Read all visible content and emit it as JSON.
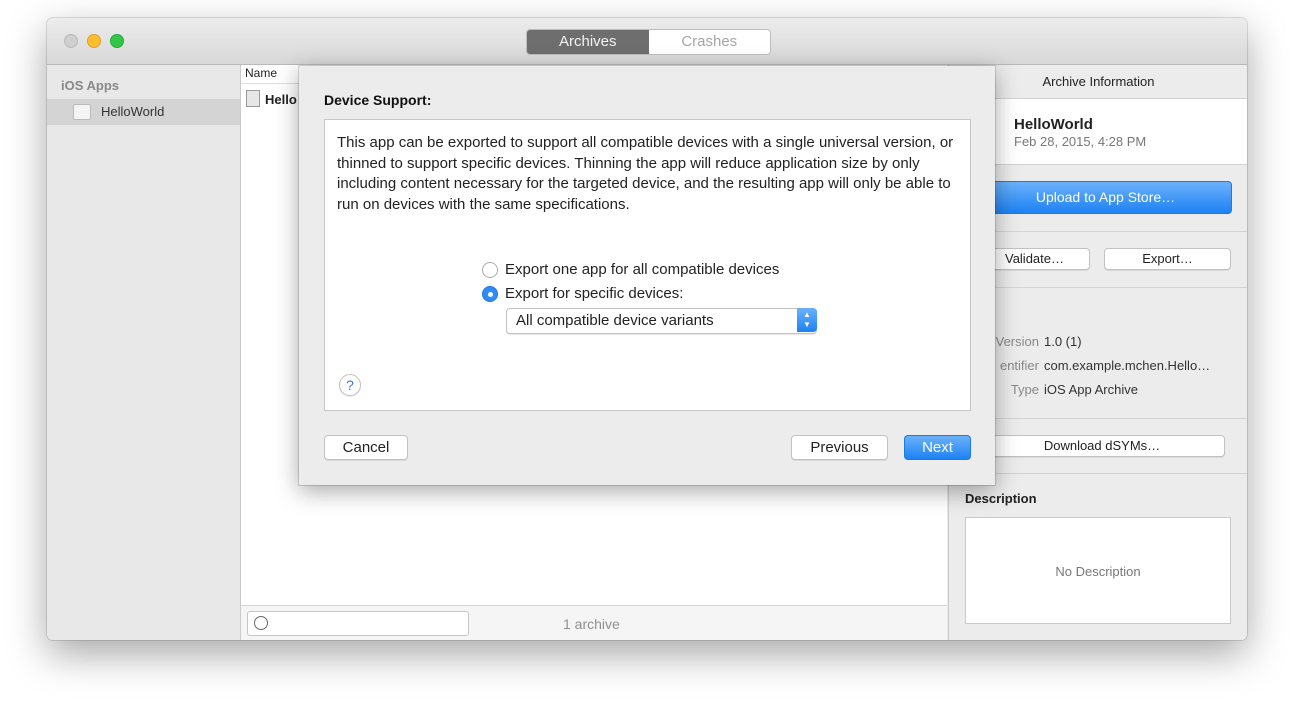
{
  "window": {
    "tabs": [
      {
        "label": "Archives",
        "active": true
      },
      {
        "label": "Crashes",
        "active": false
      }
    ]
  },
  "sidebar": {
    "header": "iOS Apps",
    "items": [
      {
        "label": "HelloWorld",
        "selected": true
      }
    ]
  },
  "list": {
    "column_header": "Name",
    "rows": [
      {
        "name": "Hello"
      }
    ],
    "footer": {
      "count": "1 archive",
      "filter_placeholder": ""
    }
  },
  "inspector": {
    "title": "Archive Information",
    "app_name": "HelloWorld",
    "date": "Feb 28, 2015, 4:28 PM",
    "upload_label": "Upload to App Store…",
    "validate_label": "Validate…",
    "export_label": "Export…",
    "details_header": "ils",
    "details": [
      {
        "key": "Version",
        "value": "1.0 (1)"
      },
      {
        "key": "entifier",
        "value": "com.example.mchen.Hello…"
      },
      {
        "key": "Type",
        "value": "iOS App Archive"
      }
    ],
    "dsyms_label": "Download dSYMs…",
    "description_header": "Description",
    "description_placeholder": "No Description"
  },
  "sheet": {
    "title": "Device Support:",
    "paragraph": "This app can be exported to support all compatible devices with a single universal version, or thinned to support specific devices.  Thinning the app will reduce application size by only including content necessary for the targeted device, and the resulting app will only be able to run on devices with the same specifications.",
    "options": [
      {
        "label": "Export one app for all compatible devices",
        "selected": false
      },
      {
        "label": "Export for specific devices:",
        "selected": true
      }
    ],
    "popup_value": "All compatible device variants",
    "help_glyph": "?",
    "cancel_label": "Cancel",
    "previous_label": "Previous",
    "next_label": "Next"
  },
  "colors": {
    "accent": "#1d82f3",
    "active_tab": "#6e6e6e"
  }
}
